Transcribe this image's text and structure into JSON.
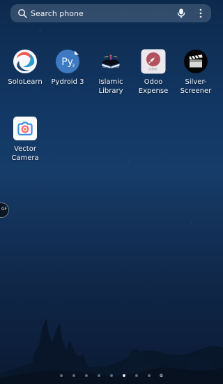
{
  "search": {
    "placeholder": "Search phone",
    "search_icon": "search-icon",
    "mic_icon": "microphone-icon",
    "menu_icon": "more-vertical-icon"
  },
  "home": {
    "apps": [
      {
        "id": "sololearn",
        "label": "SoloLearn",
        "icon": "sololearn-icon"
      },
      {
        "id": "pydroid",
        "label": "Pydroid 3",
        "icon": "pydroid-icon"
      },
      {
        "id": "islamic-library",
        "label": "Islamic\nLibrary",
        "icon": "islamic-library-icon"
      },
      {
        "id": "odoo-expense",
        "label": "Odoo\nExpense",
        "icon": "odoo-expense-icon"
      },
      {
        "id": "silver-screener",
        "label": "Silver-\nScreener",
        "icon": "clapperboard-icon"
      },
      {
        "id": "vector-camera",
        "label": "Vector\nCamera",
        "icon": "camera-icon"
      }
    ]
  },
  "edge_tab": {
    "label": "GF",
    "icon": "edge-tab-icon"
  },
  "page_indicator": {
    "dots": [
      {
        "state": "inactive"
      },
      {
        "state": "inactive"
      },
      {
        "state": "inactive"
      },
      {
        "state": "inactive"
      },
      {
        "state": "inactive"
      },
      {
        "state": "current"
      },
      {
        "state": "inactive"
      },
      {
        "state": "inactive"
      },
      {
        "state": "inactive"
      }
    ],
    "end_label": "C"
  },
  "theme": {
    "wallpaper_top": "#0d2a4d",
    "wallpaper_bottom": "#0b1a33",
    "search_bar": "#8c9cb3"
  }
}
